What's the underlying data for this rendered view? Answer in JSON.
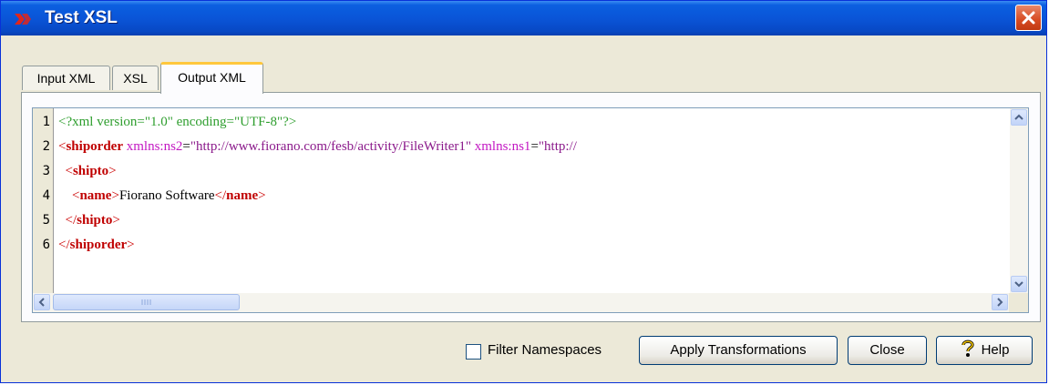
{
  "window": {
    "title": "Test XSL",
    "app_icon": "fiorano-app-icon",
    "close_icon": "close-icon"
  },
  "tabs": [
    {
      "label": "Input XML",
      "active": false
    },
    {
      "label": "XSL",
      "active": false
    },
    {
      "label": "Output XML",
      "active": true
    }
  ],
  "editor": {
    "line_numbers": [
      "1",
      "2",
      "3",
      "4",
      "5",
      "6"
    ],
    "lines": {
      "l1": "<?xml version=\"1.0\" encoding=\"UTF-8\"?>",
      "l2_tag": "shiporder",
      "l2_attr1": "xmlns:ns2",
      "l2_val1": "\"http://www.fiorano.com/fesb/activity/FileWriter1\"",
      "l2_attr2": "xmlns:ns1",
      "l2_val2": "\"http://",
      "l3_tag": "shipto",
      "l4_tag": "name",
      "l4_text": "Fiorano Software",
      "l4_close": "name",
      "l5_tag": "shipto",
      "l6_tag": "shiporder"
    }
  },
  "footer": {
    "filter_label": "Filter Namespaces",
    "filter_checked": false,
    "apply_label": "Apply Transformations",
    "close_label": "Close",
    "help_label": "Help",
    "help_icon": "help-question-icon"
  },
  "colors": {
    "titlebar": "#0a55d8",
    "tag": "#c00000",
    "attr": "#c318c3",
    "pi": "#2e9e2e"
  }
}
